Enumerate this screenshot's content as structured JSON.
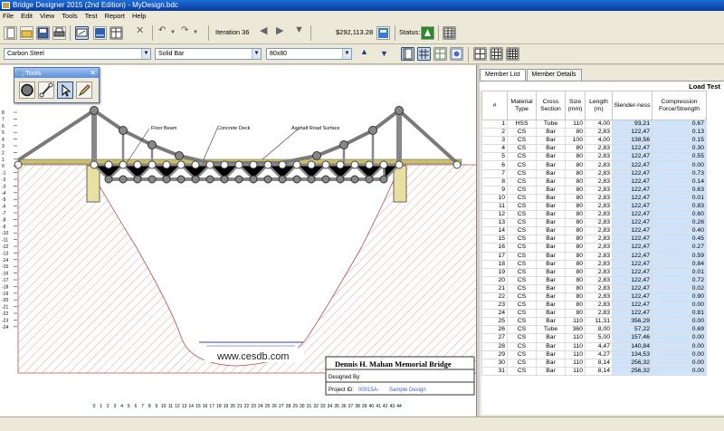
{
  "window": {
    "title": "Bridge Designer 2015 (2nd Edition) - MyDesign.bdc"
  },
  "menu": [
    "File",
    "Edit",
    "View",
    "Tools",
    "Test",
    "Report",
    "Help"
  ],
  "toolbar": {
    "iteration_label": "Iteration 36",
    "cost": "$292,113.28",
    "status_label": "Status:"
  },
  "selectors": {
    "material": "Carbon Steel",
    "section": "Solid Bar",
    "size": "80x80"
  },
  "tools_palette": {
    "title": "Tools"
  },
  "drawing": {
    "labels": {
      "floor_beam": "Floor Beam",
      "concrete_deck": "Concrete Deck",
      "asphalt": "Asphalt Road Surface",
      "website": "www.cesdb.com"
    },
    "y_ticks": [
      "8",
      "7",
      "6",
      "5",
      "4",
      "3",
      "2",
      "1",
      "0",
      "-1",
      "-2",
      "-3",
      "-4",
      "-5",
      "-6",
      "-7",
      "-8",
      "-9",
      "-10",
      "-11",
      "-12",
      "-13",
      "-14",
      "-15",
      "-16",
      "-17",
      "-18",
      "-19",
      "-20",
      "-21",
      "-22",
      "-23",
      "-24"
    ],
    "x_ticks": [
      "0",
      "1",
      "2",
      "3",
      "4",
      "5",
      "6",
      "7",
      "8",
      "9",
      "10",
      "11",
      "12",
      "13",
      "14",
      "15",
      "16",
      "17",
      "18",
      "19",
      "20",
      "21",
      "22",
      "23",
      "24",
      "25",
      "26",
      "27",
      "28",
      "29",
      "30",
      "31",
      "32",
      "33",
      "34",
      "35",
      "36",
      "37",
      "38",
      "39",
      "40",
      "41",
      "42",
      "43",
      "44"
    ],
    "title_block": {
      "bridge_name": "Dennis H. Mahan Memorial Bridge",
      "designed_by": "Designed By:",
      "project_id_label": "Project ID:",
      "project_id": "00015A-",
      "project_name": "Sample Design"
    }
  },
  "member_panel": {
    "tabs": [
      "Member List",
      "Member Details"
    ],
    "load_test_label": "Load Test",
    "headers": [
      "#",
      "Material Type",
      "Cross Section",
      "Size (mm)",
      "Length (m)",
      "Slender-ness",
      "Compression Force/Strength"
    ],
    "rows": [
      [
        "1",
        "HSS",
        "Tube",
        "110",
        "4,00",
        "93,21",
        "0.67"
      ],
      [
        "2",
        "CS",
        "Bar",
        "80",
        "2,83",
        "122,47",
        "0.13"
      ],
      [
        "3",
        "CS",
        "Bar",
        "100",
        "4,00",
        "138,56",
        "0.15"
      ],
      [
        "4",
        "CS",
        "Bar",
        "80",
        "2,83",
        "122,47",
        "0.30"
      ],
      [
        "5",
        "CS",
        "Bar",
        "80",
        "2,83",
        "122,47",
        "0.55"
      ],
      [
        "6",
        "CS",
        "Bar",
        "80",
        "2,83",
        "122,47",
        "0.00"
      ],
      [
        "7",
        "CS",
        "Bar",
        "80",
        "2,83",
        "122,47",
        "0.73"
      ],
      [
        "8",
        "CS",
        "Bar",
        "80",
        "2,83",
        "122,47",
        "0.14"
      ],
      [
        "9",
        "CS",
        "Bar",
        "80",
        "2,83",
        "122,47",
        "0.63"
      ],
      [
        "10",
        "CS",
        "Bar",
        "80",
        "2,83",
        "122,47",
        "0.01"
      ],
      [
        "11",
        "CS",
        "Bar",
        "80",
        "2,83",
        "122,47",
        "0.83"
      ],
      [
        "12",
        "CS",
        "Bar",
        "80",
        "2,83",
        "122,47",
        "0.60"
      ],
      [
        "13",
        "CS",
        "Bar",
        "80",
        "2,83",
        "122,47",
        "0.26"
      ],
      [
        "14",
        "CS",
        "Bar",
        "80",
        "2,83",
        "122,47",
        "0.40"
      ],
      [
        "15",
        "CS",
        "Bar",
        "80",
        "2,83",
        "122,47",
        "0.45"
      ],
      [
        "16",
        "CS",
        "Bar",
        "80",
        "2,83",
        "122,47",
        "0.27"
      ],
      [
        "17",
        "CS",
        "Bar",
        "80",
        "2,83",
        "122,47",
        "0.59"
      ],
      [
        "18",
        "CS",
        "Bar",
        "80",
        "2,83",
        "122,47",
        "0.84"
      ],
      [
        "19",
        "CS",
        "Bar",
        "80",
        "2,83",
        "122,47",
        "0.01"
      ],
      [
        "20",
        "CS",
        "Bar",
        "80",
        "2,83",
        "122,47",
        "0.72"
      ],
      [
        "21",
        "CS",
        "Bar",
        "80",
        "2,83",
        "122,47",
        "0.02"
      ],
      [
        "22",
        "CS",
        "Bar",
        "80",
        "2,83",
        "122,47",
        "0.90"
      ],
      [
        "23",
        "CS",
        "Bar",
        "80",
        "2,83",
        "122,47",
        "0.00"
      ],
      [
        "24",
        "CS",
        "Bar",
        "80",
        "2,83",
        "122,47",
        "0.81"
      ],
      [
        "25",
        "CS",
        "Bar",
        "110",
        "11,31",
        "356,29",
        "0.00"
      ],
      [
        "26",
        "CS",
        "Tube",
        "360",
        "8,00",
        "57,22",
        "0.69"
      ],
      [
        "27",
        "CS",
        "Bar",
        "110",
        "5,00",
        "157,46",
        "0.00"
      ],
      [
        "28",
        "CS",
        "Bar",
        "110",
        "4,47",
        "140,84",
        "0.00"
      ],
      [
        "29",
        "CS",
        "Bar",
        "110",
        "4,27",
        "134,53",
        "0.00"
      ],
      [
        "30",
        "CS",
        "Bar",
        "110",
        "8,14",
        "256,32",
        "0.00"
      ],
      [
        "31",
        "CS",
        "Bar",
        "110",
        "8,14",
        "256,32",
        "0.00"
      ]
    ]
  }
}
